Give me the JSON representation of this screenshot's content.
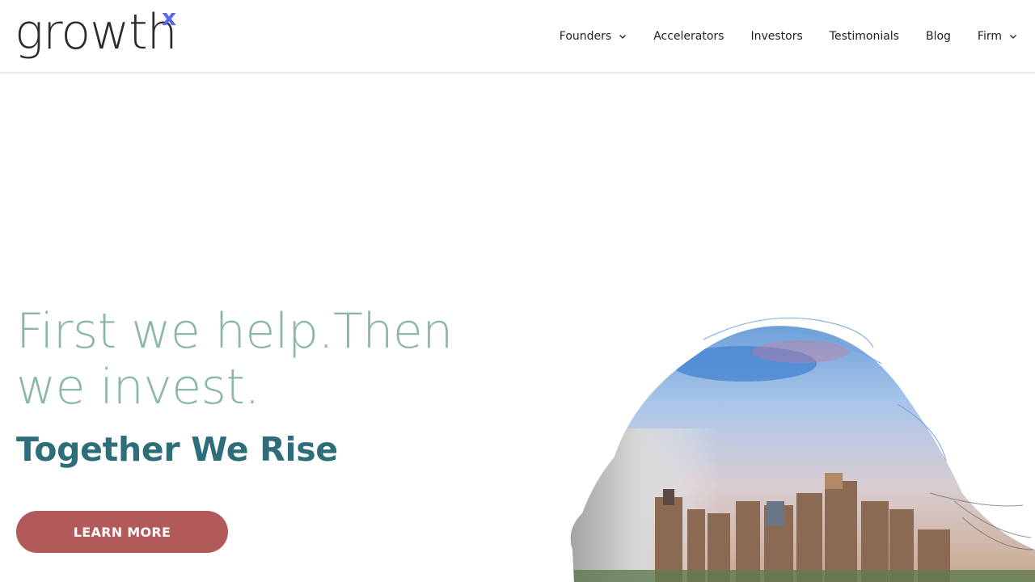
{
  "brand": {
    "logo_word": "growth",
    "logo_mark": "x",
    "accent_color": "#5a67f0"
  },
  "nav": {
    "items": [
      {
        "label": "Founders",
        "has_dropdown": true
      },
      {
        "label": "Accelerators",
        "has_dropdown": false
      },
      {
        "label": "Investors",
        "has_dropdown": false
      },
      {
        "label": "Testimonials",
        "has_dropdown": false
      },
      {
        "label": "Blog",
        "has_dropdown": false
      },
      {
        "label": "Firm",
        "has_dropdown": true
      }
    ]
  },
  "hero": {
    "title_line1": "First we help.Then",
    "title_line2": "we invest.",
    "subtitle": "Together We Rise",
    "cta_label": "LEARN MORE",
    "colors": {
      "title": "#8bb8a6",
      "subtitle": "#2e6e7b",
      "cta_background": "#b25a5a"
    },
    "image_description_icon": "woman-profile-city-skyline-image"
  }
}
